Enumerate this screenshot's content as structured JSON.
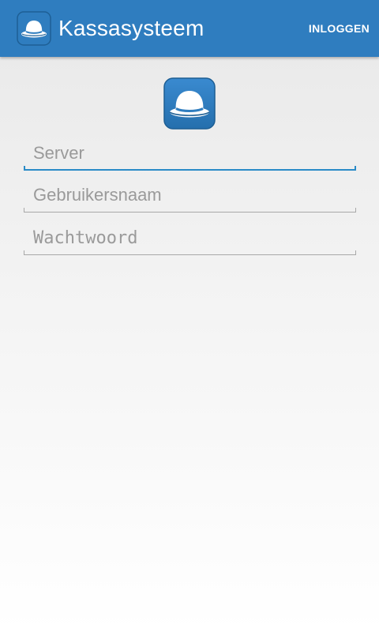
{
  "action_bar": {
    "title": "Kassasysteem",
    "login_label": "INLOGGEN",
    "icon": "bowler-hat-icon",
    "background": "#2f7dbf"
  },
  "logo": {
    "icon": "bowler-hat-icon",
    "color": "#2f7dbf"
  },
  "form": {
    "server": {
      "placeholder": "Server",
      "value": "",
      "focused": true
    },
    "username": {
      "placeholder": "Gebruikersnaam",
      "value": ""
    },
    "password": {
      "placeholder": "Wachtwoord",
      "value": ""
    }
  },
  "colors": {
    "accent": "#2a8bc7",
    "field_line": "#a8a8a8",
    "placeholder": "#9a9a9a"
  }
}
